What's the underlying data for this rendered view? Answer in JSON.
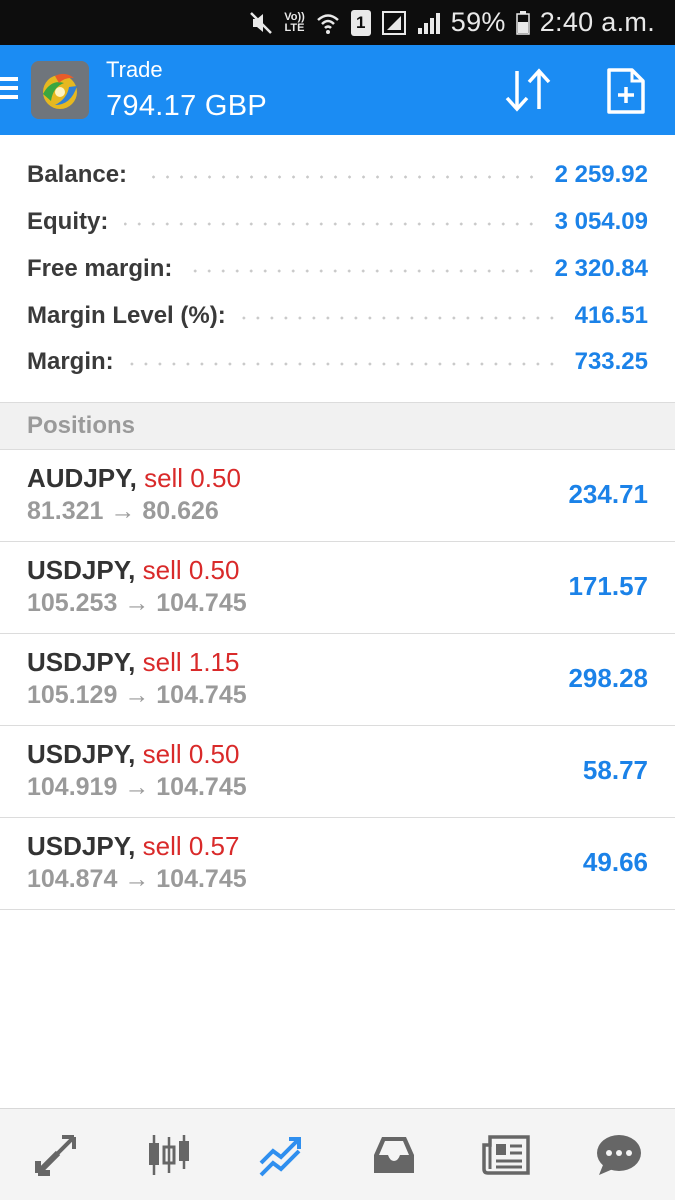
{
  "status_bar": {
    "volte_top": "Vo))",
    "volte_bottom": "LTE",
    "sim_slot": "1",
    "battery": "59%",
    "time": "2:40 a.m."
  },
  "app_bar": {
    "title": "Trade",
    "subtitle": "794.17 GBP"
  },
  "summary": [
    {
      "label": "Balance:",
      "value": "2 259.92"
    },
    {
      "label": "Equity:",
      "value": "3 054.09"
    },
    {
      "label": "Free margin:",
      "value": "2 320.84"
    },
    {
      "label": "Margin Level (%):",
      "value": "416.51"
    },
    {
      "label": "Margin:",
      "value": "733.25"
    }
  ],
  "positions_header": "Positions",
  "positions": [
    {
      "symbol": "AUDJPY,",
      "type": "sell 0.50",
      "prices": "81.321 → 80.626",
      "profit": "234.71"
    },
    {
      "symbol": "USDJPY,",
      "type": "sell 0.50",
      "prices": "105.253 → 104.745",
      "profit": "171.57"
    },
    {
      "symbol": "USDJPY,",
      "type": "sell 1.15",
      "prices": "105.129 → 104.745",
      "profit": "298.28"
    },
    {
      "symbol": "USDJPY,",
      "type": "sell 0.50",
      "prices": "104.919 → 104.745",
      "profit": "58.77"
    },
    {
      "symbol": "USDJPY,",
      "type": "sell 0.57",
      "prices": "104.874 → 104.745",
      "profit": "49.66"
    }
  ],
  "bottom_nav": [
    {
      "icon": "quotes-icon"
    },
    {
      "icon": "chart-icon"
    },
    {
      "icon": "trade-icon",
      "active": true
    },
    {
      "icon": "history-icon"
    },
    {
      "icon": "news-icon"
    },
    {
      "icon": "messages-icon"
    }
  ],
  "colors": {
    "accent": "#1b8cf3",
    "value_blue": "#1b82e8",
    "sell_red": "#d92a2a",
    "muted_gray": "#9a9a9a"
  }
}
